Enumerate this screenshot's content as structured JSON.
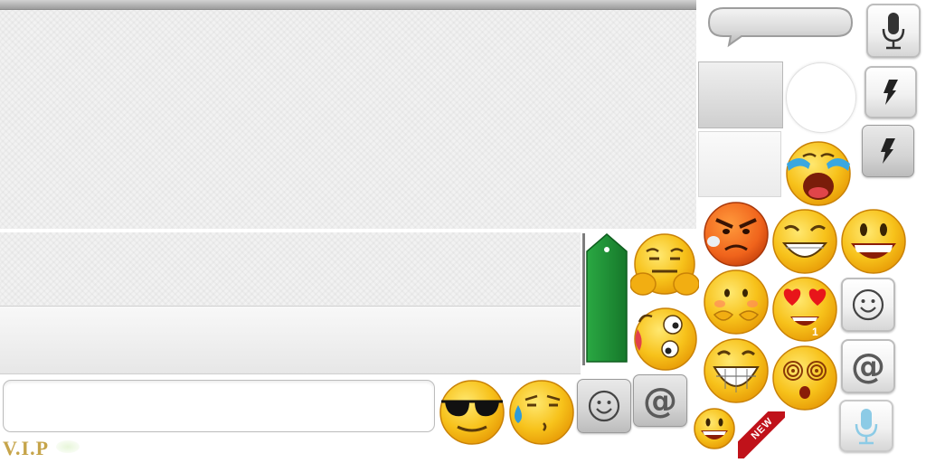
{
  "brand": {
    "vip_label": "V.I.P"
  },
  "composer": {
    "message_value": "",
    "message_placeholder": ""
  },
  "buttons": {
    "emoji_symbol": "☺",
    "mention_symbol": "@",
    "new_badge": "NEW"
  },
  "emoji_panel": {
    "badge_count": "1",
    "items": [
      "crying",
      "angry",
      "grinning-squint",
      "big-smile",
      "hugging-grin",
      "heart-eyes",
      "shy-blush",
      "tongue-dizzy",
      "teeth-grin",
      "spiral-eyes",
      "cool-sunglasses",
      "sweat-smirk",
      "small-smile"
    ]
  },
  "colors": {
    "emoji_yellow": "#f7c21b",
    "tag_green": "#1e8f33",
    "ribbon_red": "#c0121a",
    "mic_blue": "#8ccbe6",
    "vip_gold": "#c6a44a"
  }
}
